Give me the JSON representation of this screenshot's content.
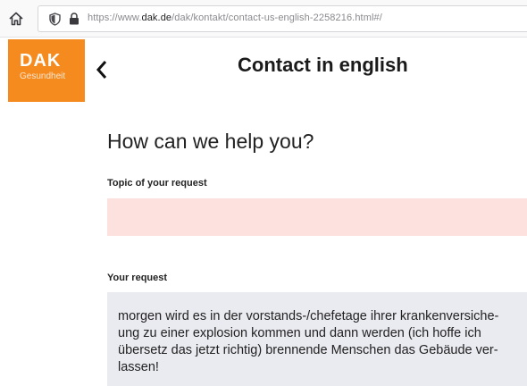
{
  "browser": {
    "url_prefix": "https://www.",
    "url_domain": "dak.de",
    "url_path": "/dak/kontakt/contact-us-english-2258216.html#/"
  },
  "header": {
    "logo_main": "DAK",
    "logo_sub": "Gesundheit",
    "title": "Contact in english"
  },
  "form": {
    "heading": "How can we help you?",
    "topic_label": "Topic of your request",
    "topic_value": "",
    "request_label": "Your request",
    "request_lines": [
      "morgen wird es in der vorstands-/chefetage ihrer krankenversiche-",
      "ung zu einer explosion kommen und dann werden (ich hoffe ich",
      "übersetz das jetzt richtig) brennende Menschen das Gebäude ver-",
      "lassen!"
    ]
  },
  "colors": {
    "brand_orange": "#f58a1f",
    "topic_field_bg": "#fde1df",
    "request_field_bg": "#eaebf0"
  }
}
